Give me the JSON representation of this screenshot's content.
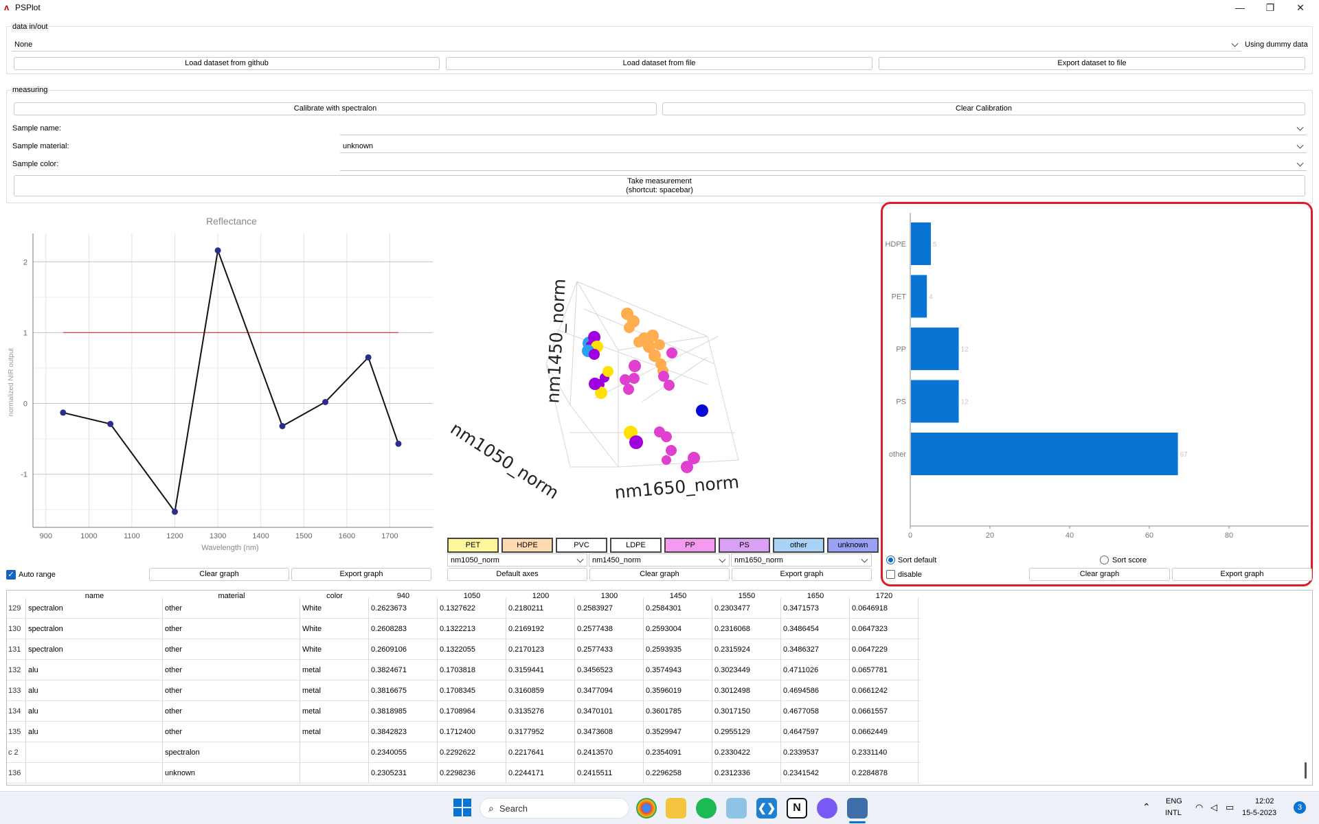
{
  "window": {
    "title": "PSPlot"
  },
  "data_inout": {
    "title": "data in/out",
    "dataset_selected": "None",
    "status": "Using dummy data",
    "load_github": "Load dataset from github",
    "load_file": "Load dataset from file",
    "export": "Export dataset to file"
  },
  "measuring": {
    "title": "measuring",
    "calibrate": "Calibrate with spectralon",
    "clear_calibration": "Clear Calibration",
    "sample_name_label": "Sample name:",
    "sample_name_value": "",
    "sample_material_label": "Sample material:",
    "sample_material_value": "unknown",
    "sample_color_label": "Sample color:",
    "sample_color_value": "",
    "take_measurement_line1": "Take measurement",
    "take_measurement_line2": "(shortcut: spacebar)"
  },
  "chart_data": [
    {
      "type": "line",
      "title": "Reflectance",
      "xlabel": "Wavelength (nm)",
      "ylabel": "normalized NIR output",
      "x": [
        940,
        1050,
        1200,
        1300,
        1450,
        1550,
        1650,
        1720
      ],
      "series": [
        {
          "values": [
            -0.13,
            -0.29,
            -1.53,
            2.16,
            -0.32,
            0.02,
            0.65,
            -0.57
          ]
        }
      ],
      "reference_line": {
        "x": [
          940,
          1720
        ],
        "y": 1
      },
      "xticks": [
        900,
        1000,
        1100,
        1200,
        1300,
        1400,
        1500,
        1600,
        1700
      ],
      "yticks": [
        -1,
        0,
        1,
        2
      ],
      "xlim": [
        870,
        1800
      ],
      "ylim": [
        -1.75,
        2.4
      ],
      "grid": true
    },
    {
      "type": "scatter",
      "projection": "3d",
      "xlabel": "nm1050_norm",
      "ylabel": "nm1650_norm",
      "zlabel": "nm1450_norm",
      "colors": {
        "PET": "#ffe000",
        "HDPE": "#ffad4f",
        "PP": "#e040d0",
        "PS": "#a000e0",
        "other": "#2aa0f0",
        "unknown": "#0a0ad8"
      }
    },
    {
      "type": "bar",
      "orientation": "horizontal",
      "categories": [
        "HDPE",
        "PET",
        "PP",
        "PS",
        "other"
      ],
      "values": [
        5,
        4,
        12,
        12,
        67
      ],
      "xticks": [
        0,
        20,
        40,
        60,
        80
      ],
      "xlim": [
        0,
        100
      ],
      "color": "#0a74d4"
    }
  ],
  "reflectance_controls": {
    "auto_range": "Auto range",
    "clear_graph": "Clear graph",
    "export_graph": "Export graph"
  },
  "materials": [
    "PET",
    "HDPE",
    "PVC",
    "LDPE",
    "PP",
    "PS",
    "other",
    "unknown"
  ],
  "material_colors": [
    "#fff59a",
    "#ffd9b0",
    "#ffffff",
    "#ffffff",
    "#f59af0",
    "#d9a0f5",
    "#a9d4f7",
    "#9aa0f5"
  ],
  "scatter_controls": {
    "axis1": "nm1050_norm",
    "axis2": "nm1450_norm",
    "axis3": "nm1650_norm",
    "default_axes": "Default axes",
    "clear_graph": "Clear graph",
    "export_graph": "Export graph"
  },
  "bar_controls": {
    "sort_default": "Sort default",
    "sort_score": "Sort score",
    "disable": "disable",
    "clear_graph": "Clear graph",
    "export_graph": "Export graph"
  },
  "table": {
    "headers": [
      "name",
      "material",
      "color",
      "940",
      "1050",
      "1200",
      "1300",
      "1450",
      "1550",
      "1650",
      "1720"
    ],
    "rows": [
      {
        "idx": "129",
        "cells": [
          "spectralon",
          "other",
          "White",
          "0.2623673",
          "0.1327622",
          "0.2180211",
          "0.2583927",
          "0.2584301",
          "0.2303477",
          "0.3471573",
          "0.0646918"
        ]
      },
      {
        "idx": "130",
        "cells": [
          "spectralon",
          "other",
          "White",
          "0.2608283",
          "0.1322213",
          "0.2169192",
          "0.2577438",
          "0.2593004",
          "0.2316068",
          "0.3486454",
          "0.0647323"
        ]
      },
      {
        "idx": "131",
        "cells": [
          "spectralon",
          "other",
          "White",
          "0.2609106",
          "0.1322055",
          "0.2170123",
          "0.2577433",
          "0.2593935",
          "0.2315924",
          "0.3486327",
          "0.0647229"
        ]
      },
      {
        "idx": "132",
        "cells": [
          "alu",
          "other",
          "metal",
          "0.3824671",
          "0.1703818",
          "0.3159441",
          "0.3456523",
          "0.3574943",
          "0.3023449",
          "0.4711026",
          "0.0657781"
        ]
      },
      {
        "idx": "133",
        "cells": [
          "alu",
          "other",
          "metal",
          "0.3816675",
          "0.1708345",
          "0.3160859",
          "0.3477094",
          "0.3596019",
          "0.3012498",
          "0.4694586",
          "0.0661242"
        ]
      },
      {
        "idx": "134",
        "cells": [
          "alu",
          "other",
          "metal",
          "0.3818985",
          "0.1708964",
          "0.3135276",
          "0.3470101",
          "0.3601785",
          "0.3017150",
          "0.4677058",
          "0.0661557"
        ]
      },
      {
        "idx": "135",
        "cells": [
          "alu",
          "other",
          "metal",
          "0.3842823",
          "0.1712400",
          "0.3177952",
          "0.3473608",
          "0.3529947",
          "0.2955129",
          "0.4647597",
          "0.0662449"
        ]
      },
      {
        "idx": "c 2",
        "cells": [
          "",
          "spectralon",
          "",
          "0.2340055",
          "0.2292622",
          "0.2217641",
          "0.2413570",
          "0.2354091",
          "0.2330422",
          "0.2339537",
          "0.2331140"
        ]
      },
      {
        "idx": "136",
        "cells": [
          "",
          "unknown",
          "",
          "0.2305231",
          "0.2298236",
          "0.2244171",
          "0.2415511",
          "0.2296258",
          "0.2312336",
          "0.2341542",
          "0.2284878"
        ]
      }
    ]
  },
  "taskbar": {
    "search": "Search",
    "lang1": "ENG",
    "lang2": "INTL",
    "time": "12:02",
    "date": "15-5-2023",
    "badge": "3"
  }
}
